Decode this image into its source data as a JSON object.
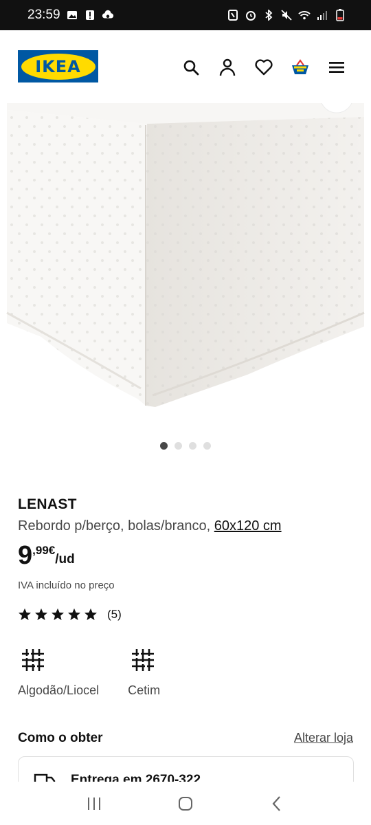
{
  "status_bar": {
    "time": "23:59",
    "left_icons": [
      "image-icon",
      "alert-icon",
      "cloud-icon"
    ],
    "right_icons": [
      "nfc-icon",
      "alarm-icon",
      "bluetooth-icon",
      "mute-icon",
      "wifi-icon",
      "signal-icon",
      "battery-icon"
    ]
  },
  "header": {
    "logo_text": "IKEA",
    "icons": [
      "search-icon",
      "account-icon",
      "heart-icon",
      "basket-icon",
      "menu-icon"
    ]
  },
  "gallery": {
    "total_images": 4,
    "active_index": 0
  },
  "product": {
    "name": "LENAST",
    "description": "Rebordo p/berço, bolas/branco, ",
    "size": "60x120 cm",
    "price_int": "9",
    "price_dec": ",99€",
    "price_unit": "/ud",
    "vat_note": "IVA incluído no preço",
    "rating_stars": 5,
    "rating_count": "(5)"
  },
  "materials": [
    {
      "label": "Algodão/Liocel",
      "icon": "fabric-weave-icon"
    },
    {
      "label": "Cetim",
      "icon": "fabric-weave-icon"
    }
  ],
  "how_to_get": {
    "title": "Como o obter",
    "change_store": "Alterar loja",
    "delivery_text": "Entrega em 2670-322"
  },
  "colors": {
    "ikea_blue": "#0058a3",
    "ikea_yellow": "#ffdb00",
    "text_primary": "#111111",
    "text_secondary": "#484848"
  }
}
